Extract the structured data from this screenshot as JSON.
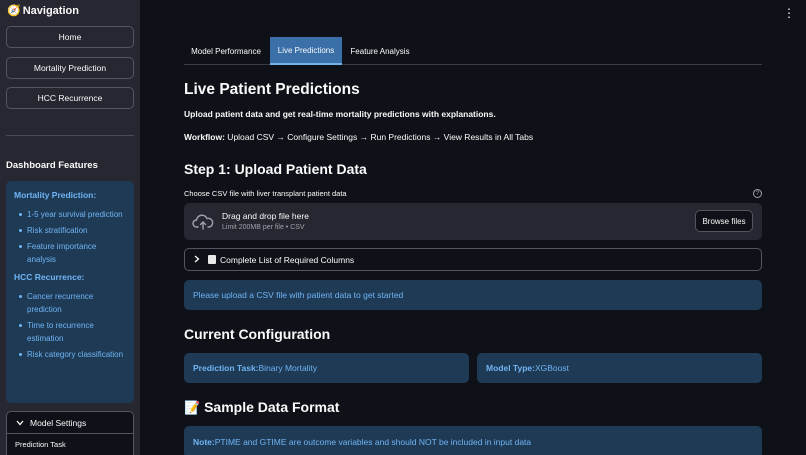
{
  "sidebar": {
    "title": "Navigation",
    "nav": [
      {
        "label": "Home"
      },
      {
        "label": "Mortality Prediction"
      },
      {
        "label": "HCC Recurrence"
      }
    ],
    "features_heading": "Dashboard Features",
    "mortality_heading": "Mortality Prediction:",
    "mortality_items": [
      "1-5 year survival prediction",
      "Risk stratification",
      "Feature importance analysis"
    ],
    "hcc_heading": "HCC Recurrence:",
    "hcc_items": [
      "Cancer recurrence prediction",
      "Time to recurrence estimation",
      "Risk category classification"
    ],
    "settings": {
      "label": "Model Settings",
      "field_label": "Prediction Task"
    }
  },
  "tabs": [
    {
      "label": "Model Performance",
      "active": false
    },
    {
      "label": "Live Predictions",
      "active": true
    },
    {
      "label": "Feature Analysis",
      "active": false
    }
  ],
  "main": {
    "title": "Live Patient Predictions",
    "lead": "Upload patient data and get real-time mortality predictions with explanations.",
    "workflow_label": "Workflow:",
    "workflow_text": " Upload CSV → Configure Settings → Run Predictions → View Results in All Tabs",
    "step1_title": "Step 1: Upload Patient Data",
    "uploader_label": "Choose CSV file with liver transplant patient data",
    "dropzone_main": "Drag and drop file here",
    "dropzone_sub": "Limit 200MB per file • CSV",
    "browse_label": "Browse files",
    "columns_expander": "Complete List of Required Columns",
    "upload_info": "Please upload a CSV file with patient data to get started",
    "config_title": "Current Configuration",
    "task_label": "Prediction Task:",
    "task_value": " Binary Mortality",
    "model_label": "Model Type:",
    "model_value": " XGBoost",
    "sample_title": "Sample Data Format",
    "note_label": "Note:",
    "note_text": " PTIME and GTIME are outcome variables and should NOT be included in input data"
  },
  "colors": {
    "background": "#0e1117",
    "sidebar": "#262730",
    "info_bg": "#1f3a55",
    "info_text": "#6fb5f5",
    "active_tab": "#3a6fa8"
  }
}
